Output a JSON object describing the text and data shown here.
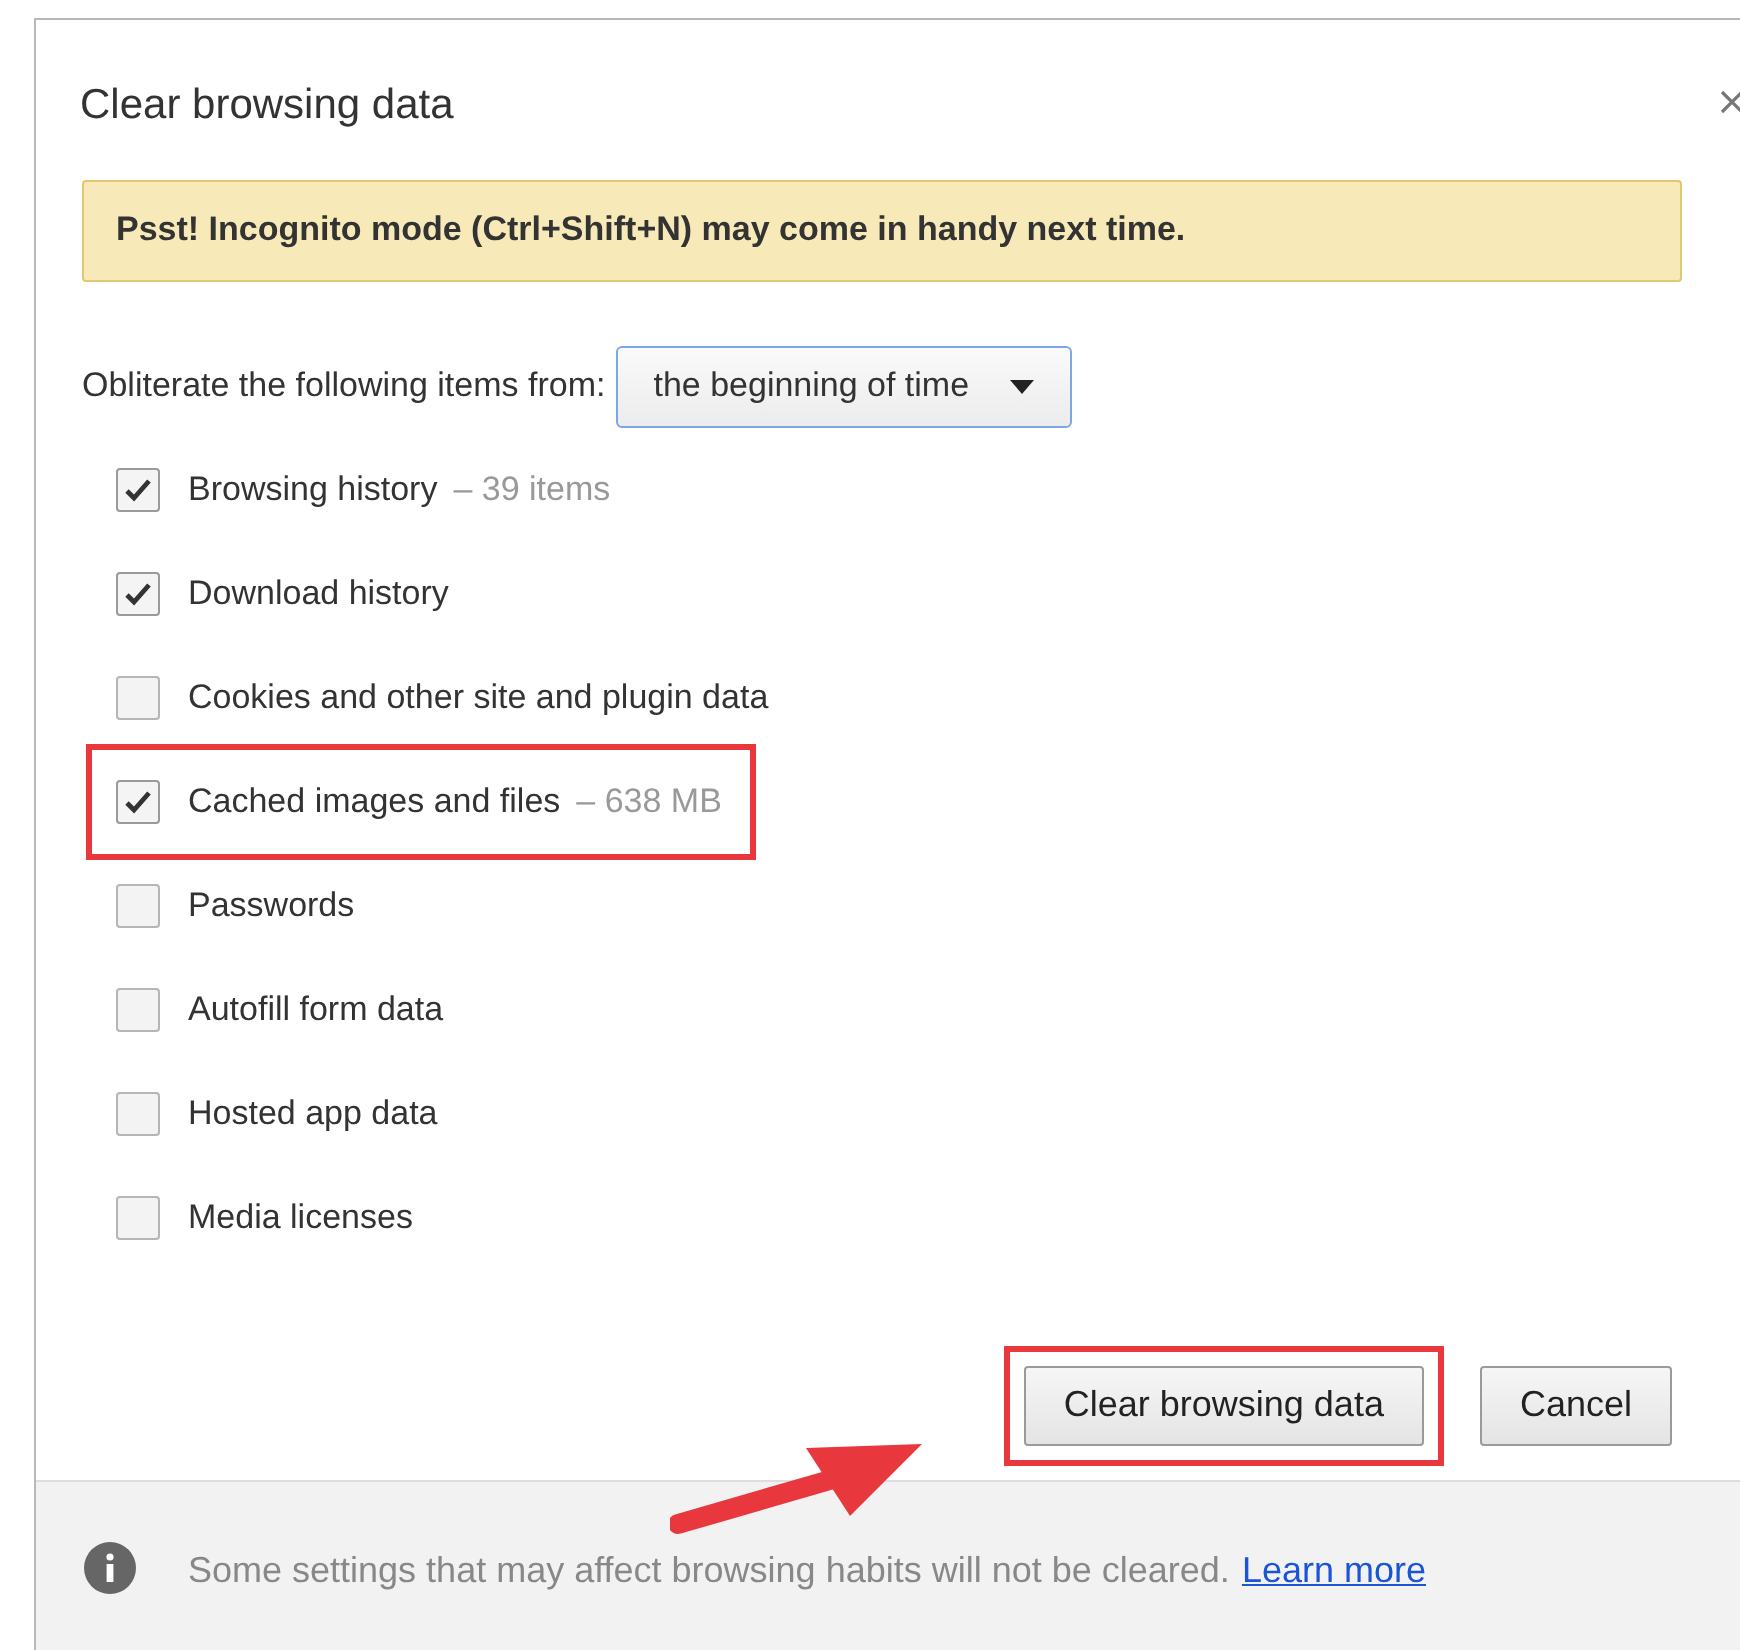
{
  "dialog": {
    "title": "Clear browsing data"
  },
  "banner": {
    "text": "Psst! Incognito mode (Ctrl+Shift+N) may come in handy next time."
  },
  "range": {
    "label": "Obliterate the following items from:",
    "value": "the beginning of time"
  },
  "items": [
    {
      "label": "Browsing history",
      "detail": "– 39 items",
      "checked": true,
      "highlighted": false
    },
    {
      "label": "Download history",
      "checked": true,
      "highlighted": false
    },
    {
      "label": "Cookies and other site and plugin data",
      "checked": false,
      "highlighted": false
    },
    {
      "label": "Cached images and files",
      "detail": "– 638 MB",
      "checked": true,
      "highlighted": true
    },
    {
      "label": "Passwords",
      "checked": false,
      "highlighted": false
    },
    {
      "label": "Autofill form data",
      "checked": false,
      "highlighted": false
    },
    {
      "label": "Hosted app data",
      "checked": false,
      "highlighted": false
    },
    {
      "label": "Media licenses",
      "checked": false,
      "highlighted": false
    }
  ],
  "buttons": [
    {
      "label": "Clear browsing data",
      "highlighted": true
    },
    {
      "label": "Cancel",
      "highlighted": false
    }
  ],
  "footer": {
    "text": "Some settings that may affect browsing habits will not be cleared.",
    "link": "Learn more"
  }
}
